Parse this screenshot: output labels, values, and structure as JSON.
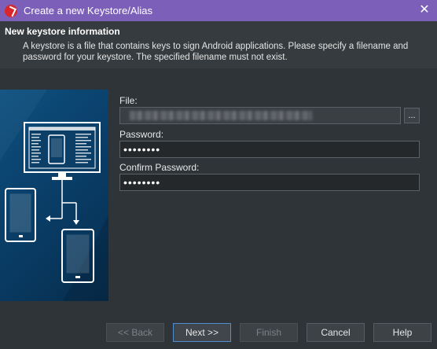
{
  "window": {
    "title": "Create a new Keystore/Alias",
    "close_glyph": "✕"
  },
  "header": {
    "title": "New keystore information",
    "description": "A keystore is a file that contains keys to sign Android applications. Please specify a filename and password for your keystore. The specified filename must not exist."
  },
  "form": {
    "file_label": "File:",
    "file_value": "",
    "browse_label": "...",
    "password_label": "Password:",
    "password_value": "••••••••",
    "confirm_label": "Confirm Password:",
    "confirm_value": "••••••••"
  },
  "buttons": {
    "back": "<< Back",
    "next": "Next >>",
    "finish": "Finish",
    "cancel": "Cancel",
    "help": "Help"
  },
  "icons": {
    "app": "app-logo-icon",
    "banner": "android-devices-illustration"
  },
  "colors": {
    "titlebar": "#7c5fb9",
    "background": "#2f3438",
    "banner": "#0a3f69",
    "focus": "#4d8fd0"
  }
}
